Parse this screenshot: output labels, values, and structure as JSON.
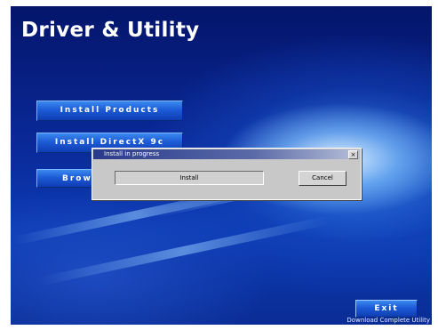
{
  "app": {
    "title": "Driver & Utility",
    "footer": "Download Complete Utility"
  },
  "menu": {
    "items": [
      {
        "label": "Install Products"
      },
      {
        "label": "Install DirectX 9c"
      },
      {
        "label": "Browse"
      }
    ]
  },
  "dialog": {
    "title": "Install in progress",
    "close_glyph": "×",
    "progress_label": "Install",
    "cancel_label": "Cancel"
  },
  "exit": {
    "label": "Exit"
  }
}
